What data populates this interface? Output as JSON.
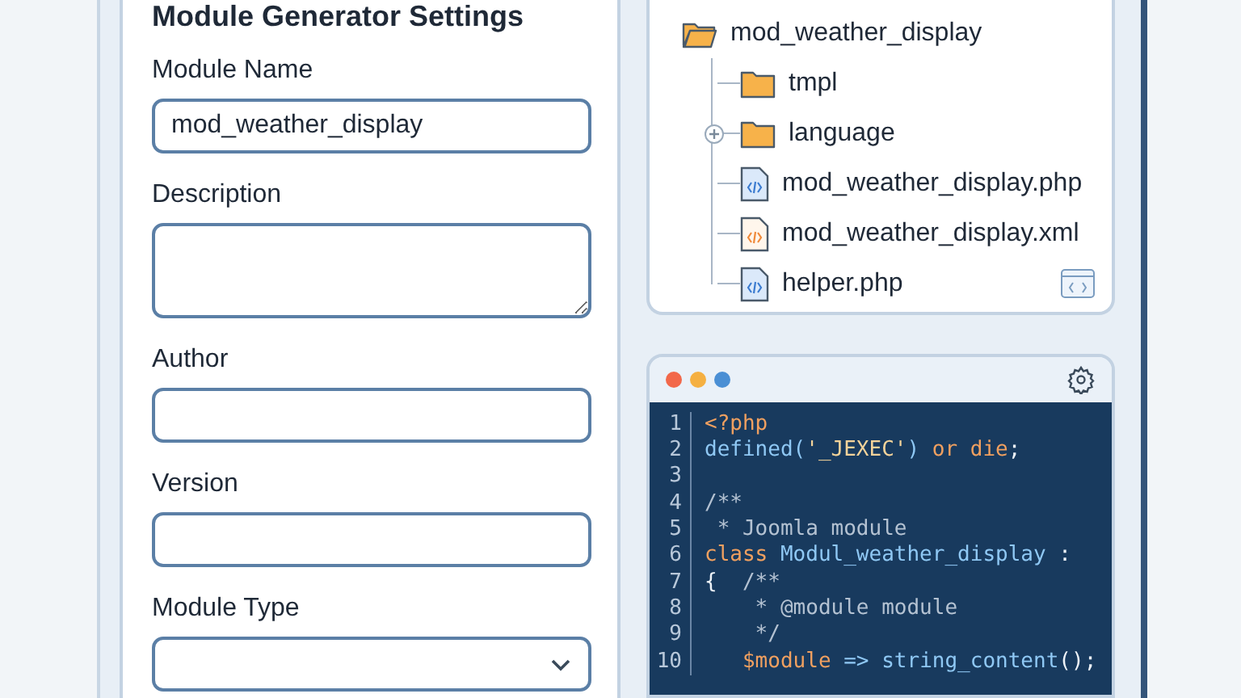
{
  "settings": {
    "title": "Module Generator Settings",
    "fields": [
      {
        "kind": "text",
        "label": "Module Name",
        "value": "mod_weather_display"
      },
      {
        "kind": "textarea",
        "label": "Description"
      },
      {
        "kind": "text",
        "label": "Author"
      },
      {
        "kind": "text",
        "label": "Version"
      },
      {
        "kind": "select",
        "label": "Module Type"
      }
    ]
  },
  "tree": {
    "items": [
      {
        "kind": "folder",
        "name": "mod_weather_display",
        "expanded": true,
        "children": [
          {
            "kind": "folder",
            "name": "tmpl",
            "expanded": false
          },
          {
            "kind": "folder",
            "name": "language",
            "expanded": false,
            "expandable": true
          },
          {
            "kind": "php",
            "name": "mod_weather_display.php"
          },
          {
            "kind": "xml",
            "name": "mod_weather_display.xml"
          },
          {
            "kind": "php",
            "name": "helper.php"
          }
        ]
      }
    ]
  },
  "editor": {
    "lines": [
      {
        "number": "1",
        "tokens": [
          {
            "kind": "keyword",
            "text": "<?php"
          }
        ]
      },
      {
        "number": "2",
        "tokens": [
          {
            "kind": "ident",
            "text": "defined("
          },
          {
            "kind": "string",
            "text": "'_JEXEC'"
          },
          {
            "kind": "ident",
            "text": ") "
          },
          {
            "kind": "keyword",
            "text": "or die"
          },
          {
            "kind": "plain",
            "text": ";"
          }
        ]
      },
      {
        "number": "3"
      },
      {
        "number": "4",
        "tokens": [
          {
            "kind": "comment",
            "text": "/**"
          }
        ]
      },
      {
        "number": "5",
        "tokens": [
          {
            "kind": "comment",
            "text": " * Joomla module"
          }
        ]
      },
      {
        "number": "6",
        "tokens": [
          {
            "kind": "keyword",
            "text": "class "
          },
          {
            "kind": "ident",
            "text": "Modul_weather_display"
          },
          {
            "kind": "plain",
            "text": " :"
          }
        ]
      },
      {
        "number": "7",
        "tokens": [
          {
            "kind": "plain",
            "text": "{  "
          },
          {
            "kind": "comment",
            "text": "/**"
          }
        ]
      },
      {
        "number": "8",
        "tokens": [
          {
            "kind": "comment",
            "text": "    * @module module"
          }
        ]
      },
      {
        "number": "9",
        "tokens": [
          {
            "kind": "comment",
            "text": "    */"
          }
        ]
      },
      {
        "number": "10",
        "tokens": [
          {
            "kind": "keyword",
            "text": "   $module"
          },
          {
            "kind": "ident",
            "text": " => string_content"
          },
          {
            "kind": "plain",
            "text": "();"
          }
        ]
      }
    ]
  }
}
